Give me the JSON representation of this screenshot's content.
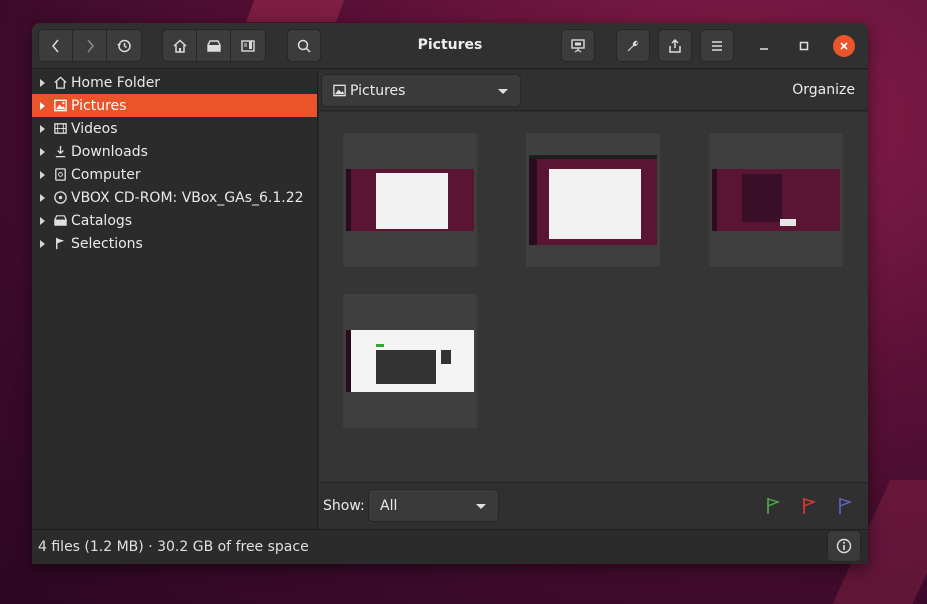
{
  "window": {
    "title": "Pictures"
  },
  "sidebar": {
    "items": [
      {
        "label": "Home Folder",
        "icon": "home-icon",
        "selected": false
      },
      {
        "label": "Pictures",
        "icon": "image-icon",
        "selected": true
      },
      {
        "label": "Videos",
        "icon": "film-icon",
        "selected": false
      },
      {
        "label": "Downloads",
        "icon": "download-icon",
        "selected": false
      },
      {
        "label": "Computer",
        "icon": "drive-icon",
        "selected": false
      },
      {
        "label": "VBOX CD-ROM: VBox_GAs_6.1.22",
        "icon": "cdrom-icon",
        "selected": false
      },
      {
        "label": "Catalogs",
        "icon": "catalog-icon",
        "selected": false
      },
      {
        "label": "Selections",
        "icon": "flag-icon",
        "selected": false
      }
    ]
  },
  "location": {
    "label": "Pictures"
  },
  "organize_label": "Organize",
  "filter": {
    "show_label": "Show:",
    "value": "All"
  },
  "flags": {
    "green": "#4caf50",
    "red": "#e53935",
    "blue": "#5c6bc0"
  },
  "status": {
    "text": "4 files (1.2 MB)  ·  30.2 GB of free space"
  },
  "accent": "#e9542a"
}
